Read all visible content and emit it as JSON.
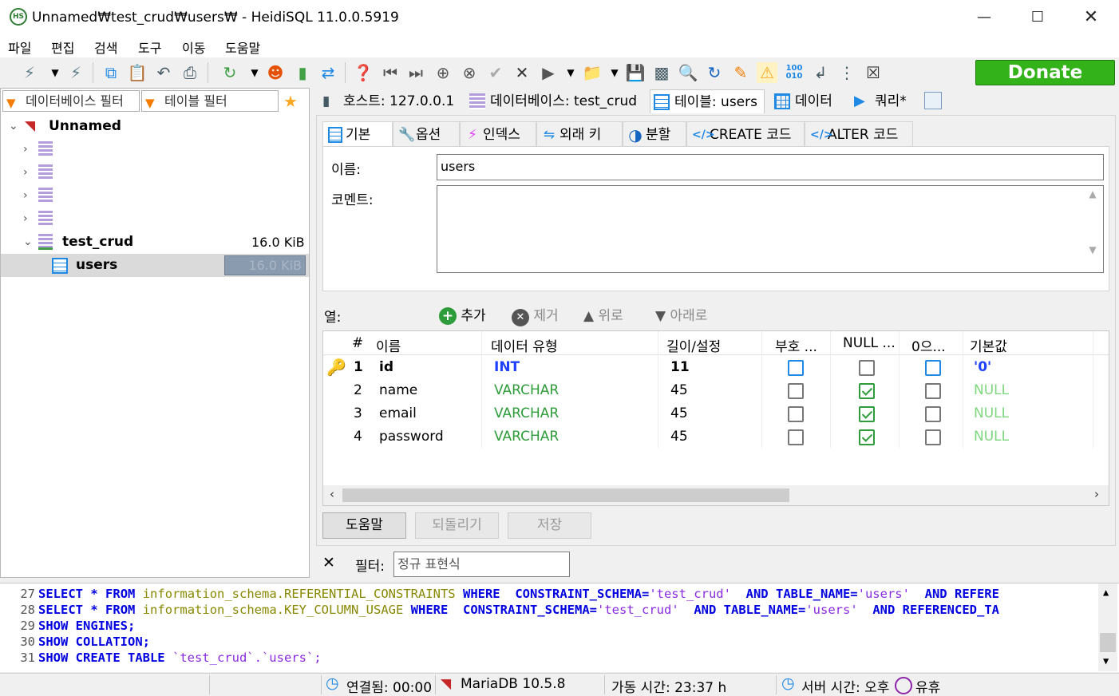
{
  "window": {
    "title": "Unnamed₩test_crud₩users₩ - HeidiSQL 11.0.0.5919",
    "app_icon_text": "HS",
    "minimize_icon": "minimize-icon",
    "maximize_icon": "maximize-icon",
    "close_icon": "close-icon"
  },
  "menu": [
    "파일",
    "편집",
    "검색",
    "도구",
    "이동",
    "도움말"
  ],
  "toolbar": {
    "donate_label": "Donate"
  },
  "left": {
    "db_filter_placeholder": "데이터베이스 필터",
    "table_filter_placeholder": "테이블 필터",
    "tree": {
      "root_label": "Unnamed",
      "db_label": "test_crud",
      "db_size": "16.0 KiB",
      "table_label": "users",
      "table_size": "16.0 KiB"
    }
  },
  "tabs": {
    "host": "호스트: 127.0.0.1",
    "database": "데이터베이스: test_crud",
    "table": "테이블: users",
    "data": "데이터",
    "query": "쿼리*"
  },
  "subtabs": {
    "basic": "기본",
    "options": "옵션",
    "indexes": "인덱스",
    "foreign_keys": "외래 키",
    "partition": "분할",
    "create_code": "CREATE 코드",
    "alter_code": "ALTER 코드"
  },
  "basic": {
    "name_label": "이름:",
    "name_value": "users",
    "comment_label": "코멘트:",
    "comment_value": ""
  },
  "columns": {
    "label": "열:",
    "add": "추가",
    "remove": "제거",
    "up": "위로",
    "down": "아래로",
    "headers": [
      "#",
      "이름",
      "데이터 유형",
      "길이/설정",
      "부호 ...",
      "NULL ...",
      "0으...",
      "기본값"
    ],
    "rows": [
      {
        "num": "1",
        "name": "id",
        "type": "INT",
        "length": "11",
        "unsigned": false,
        "allow_null": false,
        "zerofill": false,
        "default": "'0'",
        "primary": true
      },
      {
        "num": "2",
        "name": "name",
        "type": "VARCHAR",
        "length": "45",
        "unsigned": false,
        "allow_null": true,
        "zerofill": false,
        "default": "NULL",
        "primary": false
      },
      {
        "num": "3",
        "name": "email",
        "type": "VARCHAR",
        "length": "45",
        "unsigned": false,
        "allow_null": true,
        "zerofill": false,
        "default": "NULL",
        "primary": false
      },
      {
        "num": "4",
        "name": "password",
        "type": "VARCHAR",
        "length": "45",
        "unsigned": false,
        "allow_null": true,
        "zerofill": false,
        "default": "NULL",
        "primary": false
      }
    ]
  },
  "buttons": {
    "help": "도움말",
    "revert": "되돌리기",
    "save": "저장"
  },
  "filter": {
    "label": "필터:",
    "placeholder": "정규 표현식"
  },
  "log": {
    "l27": {
      "num": "27",
      "a": "SELECT",
      "b": "*",
      "c": "FROM",
      "d": "information_schema.REFERENTIAL_CONSTRAINTS",
      "e": "WHERE",
      "f": "CONSTRAINT_SCHEMA=",
      "g": "'test_crud'",
      "h": "AND",
      "i": "TABLE_NAME=",
      "j": "'users'",
      "k": "AND",
      "l": "REFERE"
    },
    "l28": {
      "num": "28",
      "a": "SELECT",
      "b": "*",
      "c": "FROM",
      "d": "information_schema.KEY_COLUMN_USAGE",
      "e": "WHERE",
      "f": "CONSTRAINT_SCHEMA=",
      "g": "'test_crud'",
      "h": "AND",
      "i": "TABLE_NAME=",
      "j": "'users'",
      "k": "AND",
      "l": "REFERENCED_TA"
    },
    "l29": {
      "num": "29",
      "text": "SHOW ENGINES;"
    },
    "l30": {
      "num": "30",
      "text": "SHOW COLLATION;"
    },
    "l31": {
      "num": "31",
      "kw": "SHOW CREATE TABLE",
      "rest": "`test_crud`.`users`;"
    }
  },
  "status": {
    "connected": "연결됨: 00:00",
    "server": "MariaDB 10.5.8",
    "uptime": "가동 시간: 23:37 h",
    "server_time": "서버 시간: 오후",
    "idle": "유휴"
  }
}
